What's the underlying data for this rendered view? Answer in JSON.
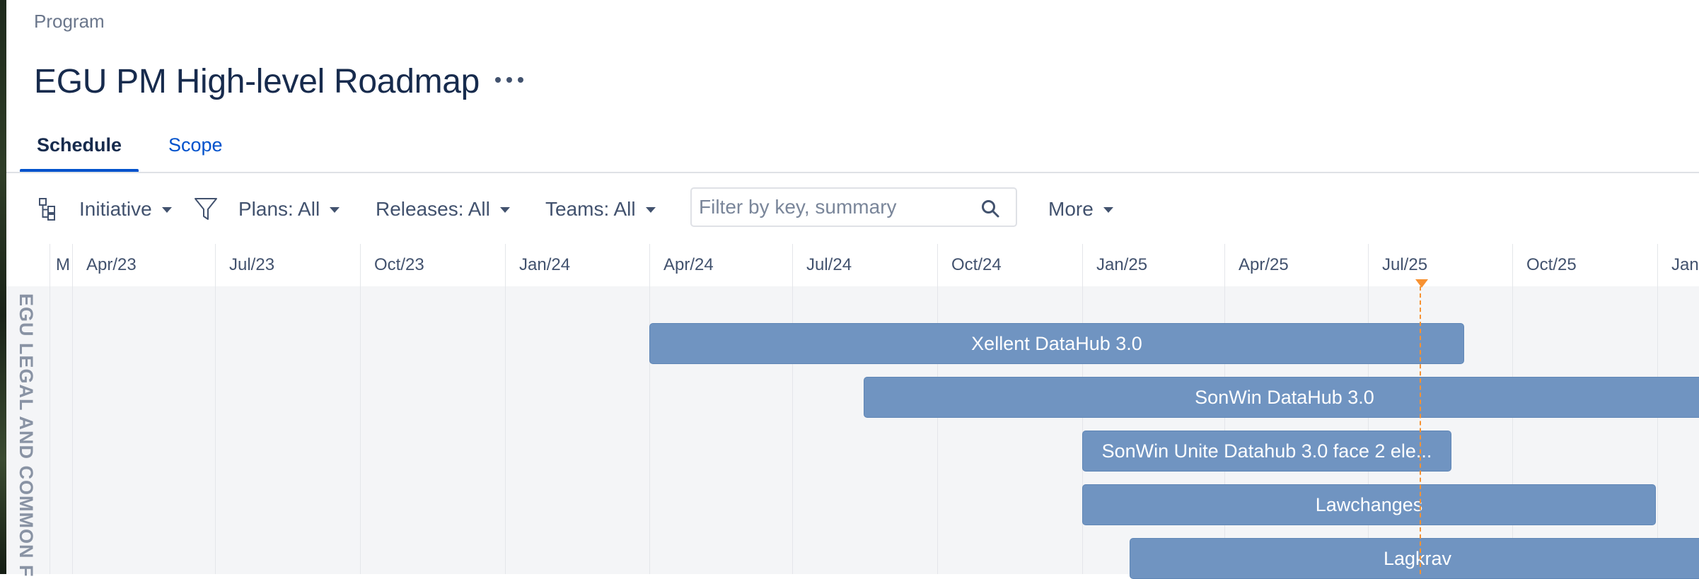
{
  "breadcrumb": "Program",
  "title": "EGU PM High-level Roadmap",
  "tabs": [
    {
      "label": "Schedule",
      "active": true
    },
    {
      "label": "Scope",
      "active": false
    }
  ],
  "toolbar": {
    "initiative": "Initiative",
    "plans": "Plans: All",
    "releases": "Releases: All",
    "teams": "Teams: All",
    "search_placeholder": "Filter by key, summary",
    "more": "More"
  },
  "timeline": {
    "months": [
      "M",
      "Apr/23",
      "Jul/23",
      "Oct/23",
      "Jan/24",
      "Apr/24",
      "Jul/24",
      "Oct/24",
      "Jan/25",
      "Apr/25",
      "Jul/25",
      "Oct/25",
      "Jan"
    ],
    "swimlane": "EGU LEGAL AND COMMON F",
    "today_color": "#f79232",
    "bar_color": "#7094c1",
    "bars": [
      {
        "label": "Xellent DataHub 3.0"
      },
      {
        "label": "SonWin DataHub 3.0"
      },
      {
        "label": "SonWin Unite Datahub 3.0 face 2 ele..."
      },
      {
        "label": "Lawchanges"
      },
      {
        "label": "Lagkrav"
      }
    ]
  }
}
